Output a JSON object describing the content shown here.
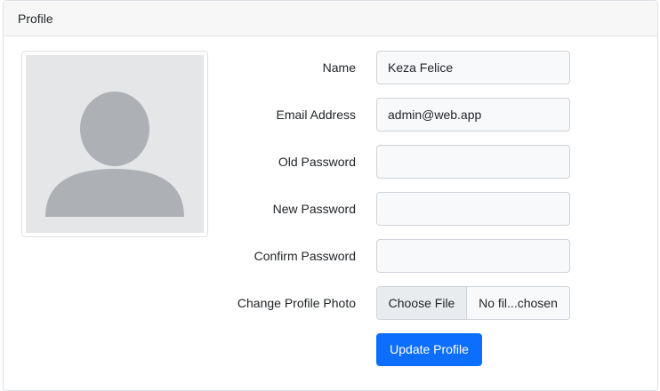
{
  "card": {
    "title": "Profile"
  },
  "avatar": {
    "icon": "person-placeholder-icon"
  },
  "form": {
    "name": {
      "label": "Name",
      "value": "Keza Felice"
    },
    "email": {
      "label": "Email Address",
      "value": "admin@web.app"
    },
    "old_password": {
      "label": "Old Password",
      "value": ""
    },
    "new_password": {
      "label": "New Password",
      "value": ""
    },
    "confirm_password": {
      "label": "Confirm Password",
      "value": ""
    },
    "photo": {
      "label": "Change Profile Photo",
      "button": "Choose File",
      "status": "No fil...chosen"
    },
    "submit": "Update Profile"
  },
  "colors": {
    "primary": "#0d6efd",
    "header_bg": "#f7f7f7",
    "avatar_bg": "#e5e6e8",
    "avatar_fg": "#adb1b6"
  }
}
